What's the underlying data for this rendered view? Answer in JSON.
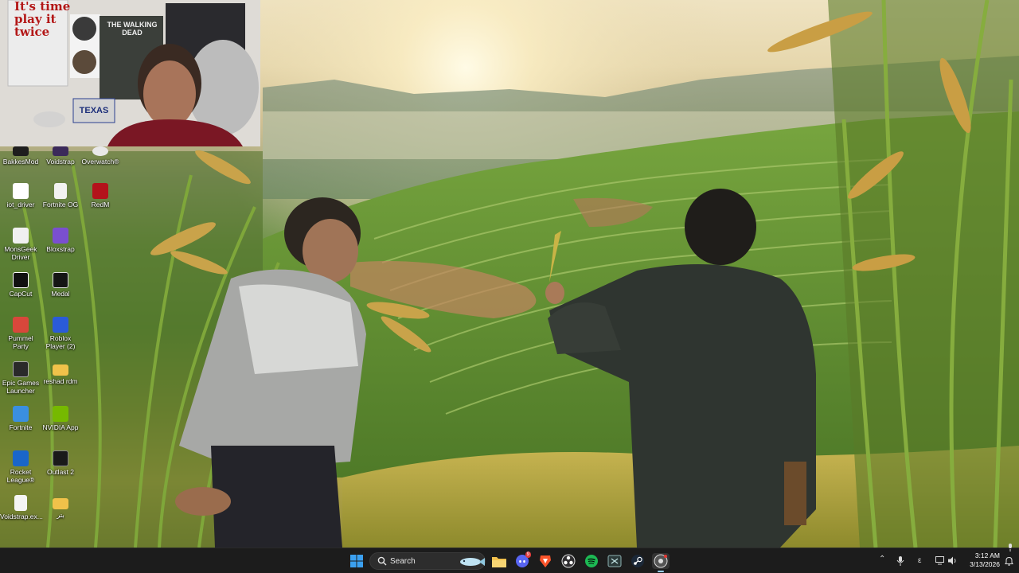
{
  "desktop": {
    "icons": [
      {
        "label": "BakkesMod",
        "icon": "bakkesmod-icon",
        "color": "#1e1e1e"
      },
      {
        "label": "Voidstrap",
        "icon": "voidstrap-icon",
        "color": "#3b2a5a"
      },
      {
        "label": "Overwatch®",
        "icon": "overwatch-icon",
        "color": "#e8e8e8"
      },
      {
        "label": "iot_driver",
        "icon": "iot-driver-icon",
        "color": "#ffffff"
      },
      {
        "label": "Fortnite OG",
        "icon": "file-icon",
        "color": "#f2f2f2"
      },
      {
        "label": "RedM",
        "icon": "redm-icon",
        "color": "#b4121b"
      },
      {
        "label": "MonsGeek Driver",
        "icon": "monsgeek-icon",
        "color": "#f0f0f0"
      },
      {
        "label": "Bloxstrap",
        "icon": "bloxstrap-icon",
        "color": "#7a4fcf"
      },
      {
        "label": "CapCut",
        "icon": "capcut-icon",
        "color": "#111111"
      },
      {
        "label": "Medal",
        "icon": "medal-icon",
        "color": "#151515"
      },
      {
        "label": "Pummel Party",
        "icon": "pummel-party-icon",
        "color": "#d8473b"
      },
      {
        "label": "Roblox Player (2)",
        "icon": "roblox-icon",
        "color": "#2a5bd8"
      },
      {
        "label": "Epic Games Launcher",
        "icon": "epic-games-icon",
        "color": "#2a2a2a"
      },
      {
        "label": "reshad rdm",
        "icon": "folder-icon",
        "color": "#f0c24a"
      },
      {
        "label": "Fortnite",
        "icon": "fortnite-icon",
        "color": "#3a8fe0"
      },
      {
        "label": "NVIDIA App",
        "icon": "nvidia-icon",
        "color": "#76b900"
      },
      {
        "label": "Rocket League®",
        "icon": "rocket-league-icon",
        "color": "#1a66c9"
      },
      {
        "label": "Outlast 2",
        "icon": "outlast-icon",
        "color": "#1a1a1a"
      },
      {
        "label": "Voidstrap.ex...",
        "icon": "file-icon",
        "color": "#f5f5f5"
      },
      {
        "label": "بتر",
        "icon": "folder-icon",
        "color": "#f0c24a"
      }
    ]
  },
  "webcam": {
    "poster_text_1": "It's time",
    "poster_text_2": "play it",
    "poster_text_3": "twice",
    "dvd_text": "THE WALKING DEAD",
    "plate_text": "TEXAS"
  },
  "taskbar": {
    "search_placeholder": "Search",
    "apps": [
      {
        "name": "start-button",
        "icon": "windows-icon"
      },
      {
        "name": "search-box",
        "icon": "search-icon"
      },
      {
        "name": "widget-fish",
        "icon": "fish-widget-icon"
      },
      {
        "name": "file-explorer",
        "icon": "folder-icon"
      },
      {
        "name": "discord",
        "icon": "discord-icon",
        "badge": "9"
      },
      {
        "name": "brave",
        "icon": "brave-icon"
      },
      {
        "name": "obs",
        "icon": "obs-icon"
      },
      {
        "name": "spotify",
        "icon": "spotify-icon"
      },
      {
        "name": "xbox-app",
        "icon": "app-icon"
      },
      {
        "name": "steam",
        "icon": "steam-icon"
      },
      {
        "name": "chrome",
        "icon": "chrome-icon"
      }
    ],
    "tray": {
      "language": "ε",
      "time": "3:12 AM",
      "date": "3/13/2026"
    }
  },
  "colors": {
    "taskbar_bg": "#1c1c1c",
    "accent": "#0078d4"
  }
}
